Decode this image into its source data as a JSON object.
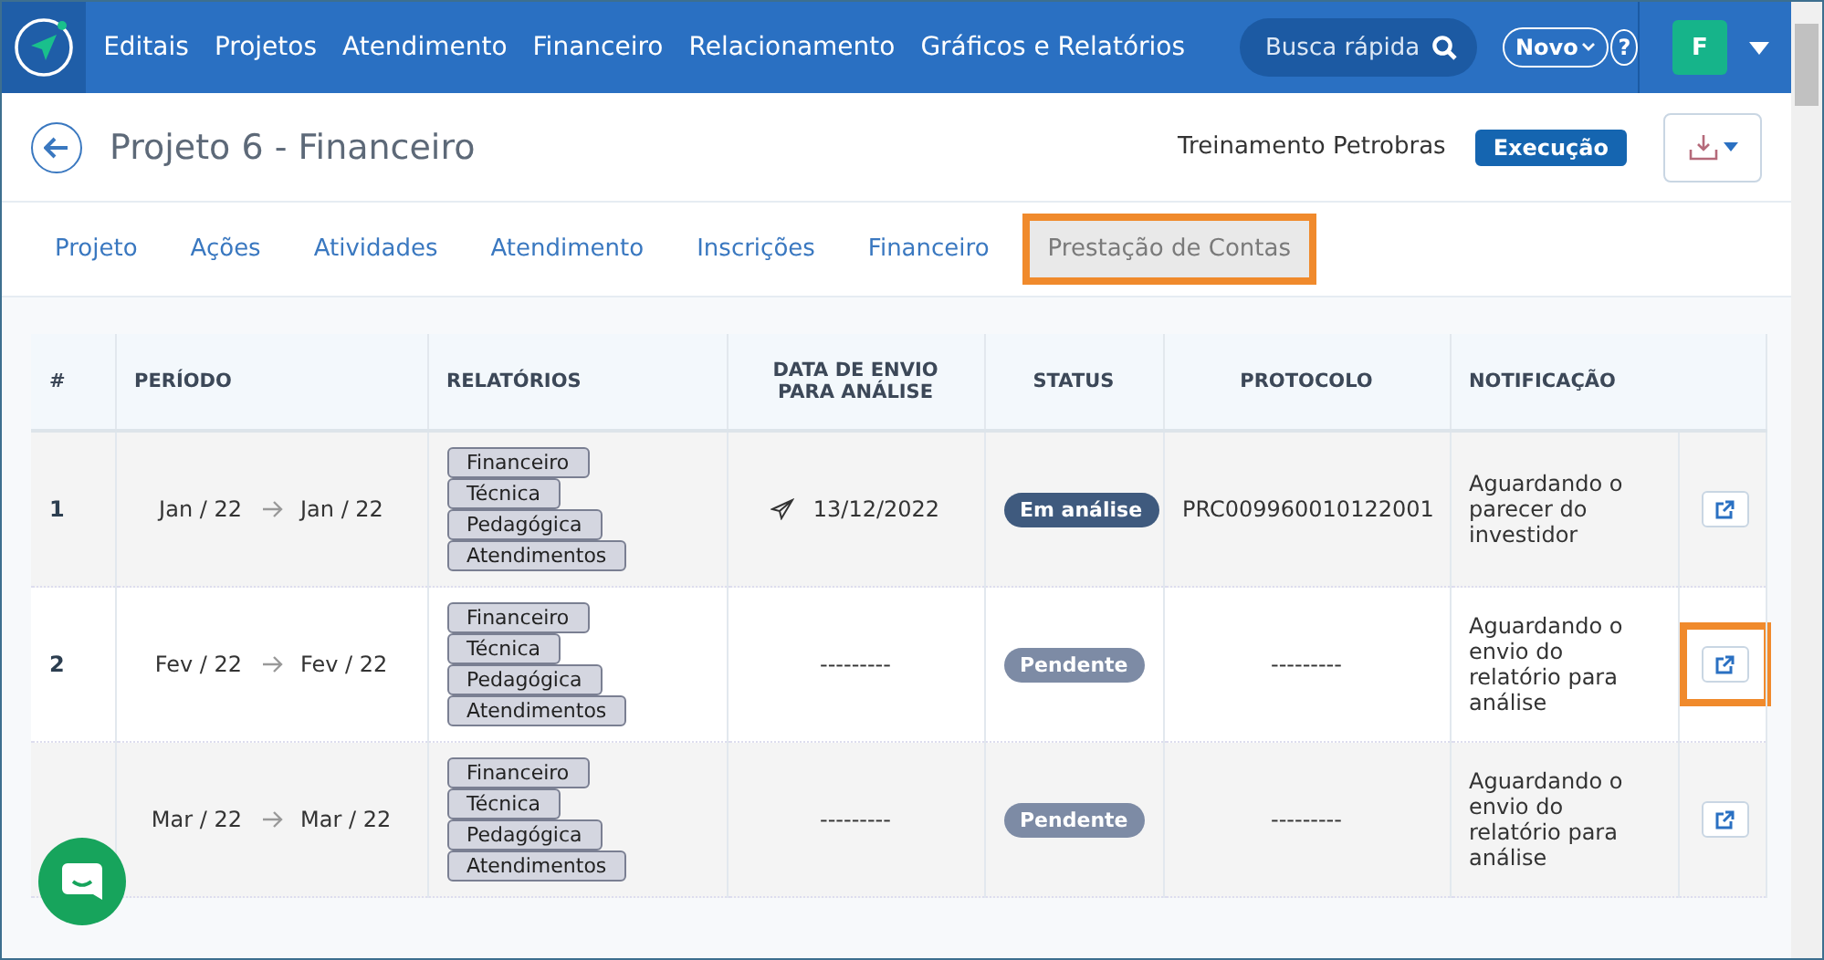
{
  "nav": {
    "items": [
      "Editais",
      "Projetos",
      "Atendimento",
      "Financeiro",
      "Relacionamento",
      "Gráficos e Relatórios"
    ],
    "search": {
      "placeholder": "Busca rápida"
    },
    "new_button": "Novo",
    "help": "?",
    "avatar": "F"
  },
  "header": {
    "title": "Projeto 6 - Financeiro",
    "client": "Treinamento Petrobras",
    "phase": "Execução"
  },
  "tabs": [
    {
      "label": "Projeto",
      "selected": false,
      "highlighted": false
    },
    {
      "label": "Ações",
      "selected": false,
      "highlighted": false
    },
    {
      "label": "Atividades",
      "selected": false,
      "highlighted": false
    },
    {
      "label": "Atendimento",
      "selected": false,
      "highlighted": false
    },
    {
      "label": "Inscrições",
      "selected": false,
      "highlighted": false
    },
    {
      "label": "Financeiro",
      "selected": false,
      "highlighted": false
    },
    {
      "label": "Prestação de Contas",
      "selected": true,
      "highlighted": true
    }
  ],
  "table": {
    "columns": [
      "#",
      "PERÍODO",
      "RELATÓRIOS",
      "DATA DE ENVIO PARA ANÁLISE",
      "STATUS",
      "PROTOCOLO",
      "NOTIFICAÇÃO"
    ],
    "rows": [
      {
        "number": "1",
        "from": "Jan / 22",
        "to": "Jan / 22",
        "reports": [
          "Financeiro",
          "Técnica",
          "Pedagógica",
          "Atendimentos"
        ],
        "sent": {
          "kind": "date",
          "text": "13/12/2022"
        },
        "status": {
          "kind": "review",
          "text": "Em análise"
        },
        "protocol": "PRC009960010122001",
        "notification": "Aguardando o parecer do investidor",
        "action_highlighted": false
      },
      {
        "number": "2",
        "from": "Fev / 22",
        "to": "Fev / 22",
        "reports": [
          "Financeiro",
          "Técnica",
          "Pedagógica",
          "Atendimentos"
        ],
        "sent": {
          "kind": "empty",
          "text": "---------"
        },
        "status": {
          "kind": "pending",
          "text": "Pendente"
        },
        "protocol": "---------",
        "notification": "Aguardando o envio do relatório para análise",
        "action_highlighted": true
      },
      {
        "from": "Mar / 22",
        "to": "Mar / 22",
        "reports": [
          "Financeiro",
          "Técnica",
          "Pedagógica",
          "Atendimentos"
        ],
        "sent": {
          "kind": "empty",
          "text": "---------"
        },
        "status": {
          "kind": "pending",
          "text": "Pendente"
        },
        "protocol": "---------",
        "notification": "Aguardando o envio do relatório para análise",
        "action_highlighted": false
      }
    ]
  }
}
